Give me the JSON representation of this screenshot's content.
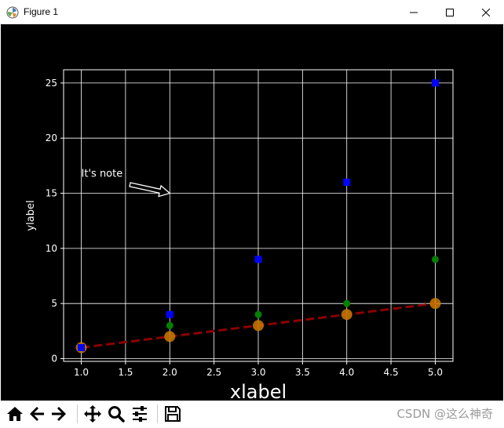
{
  "window": {
    "title": "Figure 1",
    "app_icon": "matplotlib-icon",
    "controls": [
      "minimize-icon",
      "maximize-icon",
      "close-icon"
    ]
  },
  "chart_data": {
    "type": "scatter",
    "background": "#000000",
    "grid": true,
    "xlabel": "xlabel",
    "ylabel": "ylabel",
    "xlim": [
      0.8,
      5.2
    ],
    "ylim": [
      -0.25,
      26.2
    ],
    "xticks": [
      "1.0",
      "1.5",
      "2.0",
      "2.5",
      "3.0",
      "3.5",
      "4.0",
      "4.5",
      "5.0"
    ],
    "yticks": [
      "0",
      "5",
      "10",
      "15",
      "20",
      "25"
    ],
    "series": [
      {
        "style": "dashed-line-with-circles",
        "color": "#8b0000",
        "marker_color": "#cc7a00",
        "x": [
          1,
          2,
          3,
          4,
          5
        ],
        "y": [
          1,
          2,
          3,
          4,
          5
        ]
      },
      {
        "style": "green-circles",
        "color": "#008000",
        "x": [
          1,
          2,
          3,
          4,
          5
        ],
        "y": [
          1,
          3,
          4,
          5,
          9
        ]
      },
      {
        "style": "blue-squares",
        "color": "#0000ff",
        "x": [
          1,
          2,
          3,
          4,
          5
        ],
        "y": [
          1,
          4,
          9,
          16,
          25
        ]
      }
    ],
    "annotation": {
      "text": "It's note",
      "text_x": 1.0,
      "text_y": 16.5,
      "arrow_to_x": 2.0,
      "arrow_to_y": 15.0
    }
  },
  "toolbar": {
    "buttons": [
      "home-icon",
      "back-icon",
      "forward-icon",
      "pan-icon",
      "zoom-icon",
      "configure-subplots-icon",
      "save-icon"
    ]
  },
  "watermark": "CSDN @这么神奇"
}
